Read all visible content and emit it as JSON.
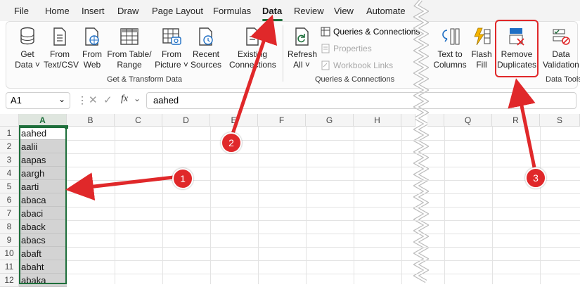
{
  "menu": {
    "tabs": [
      "File",
      "Home",
      "Insert",
      "Draw",
      "Page Layout",
      "Formulas",
      "Data",
      "Review",
      "View",
      "Automate"
    ],
    "active": "Data"
  },
  "ribbon": {
    "get_transform": {
      "buttons": [
        {
          "label1": "Get",
          "label2": "Data ˅"
        },
        {
          "label1": "From",
          "label2": "Text/CSV"
        },
        {
          "label1": "From",
          "label2": "Web"
        },
        {
          "label1": "From Table/",
          "label2": "Range"
        },
        {
          "label1": "From",
          "label2": "Picture ˅"
        },
        {
          "label1": "Recent",
          "label2": "Sources"
        },
        {
          "label1": "Existing",
          "label2": "Connections"
        }
      ],
      "group_label": "Get & Transform Data"
    },
    "queries": {
      "refresh": {
        "label1": "Refresh",
        "label2": "All ˅"
      },
      "queries_connections": "Queries & Connections",
      "properties": "Properties",
      "workbook_links": "Workbook Links",
      "group_label": "Queries & Connections"
    },
    "data_tools": {
      "buttons": [
        {
          "label1": "Text to",
          "label2": "Columns"
        },
        {
          "label1": "Flash",
          "label2": "Fill"
        },
        {
          "label1": "Remove",
          "label2": "Duplicates"
        },
        {
          "label1": "Data",
          "label2": "Validation ˅"
        }
      ],
      "group_label": "Data Tools"
    }
  },
  "formula_bar": {
    "name_box": "A1",
    "fx": "fx",
    "value": "aahed"
  },
  "grid": {
    "columns": [
      "A",
      "B",
      "C",
      "D",
      "E",
      "F",
      "G",
      "H",
      "Q",
      "R",
      "S"
    ],
    "rows": [
      "1",
      "2",
      "3",
      "4",
      "5",
      "6",
      "7",
      "8",
      "9",
      "10",
      "11",
      "12"
    ],
    "column_a_values": [
      "aahed",
      "aalii",
      "aapas",
      "aargh",
      "aarti",
      "abaca",
      "abaci",
      "aback",
      "abacs",
      "abaft",
      "abaht",
      "abaka"
    ]
  },
  "callouts": [
    "1",
    "2",
    "3"
  ],
  "colors": {
    "accent_green": "#1e6f3b",
    "callout_red": "#e0282a",
    "selection_gray": "#d3d3d3"
  }
}
